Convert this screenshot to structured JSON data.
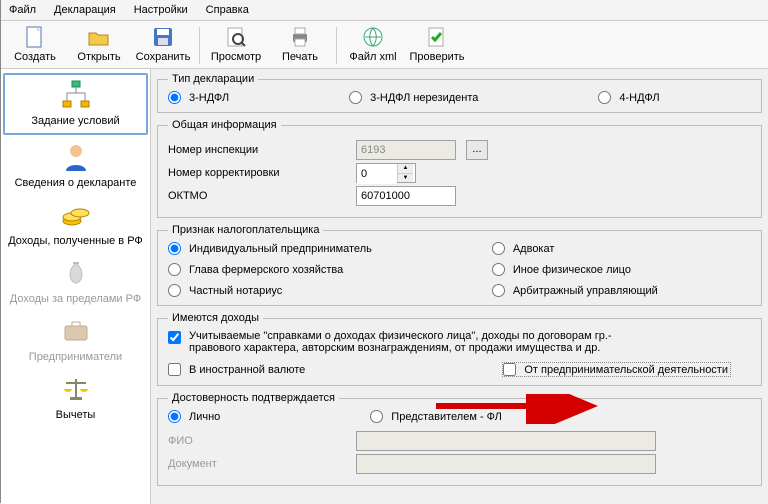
{
  "menu": {
    "items": [
      "Файл",
      "Декларация",
      "Настройки",
      "Справка"
    ]
  },
  "toolbar": {
    "items": [
      {
        "label": "Создать",
        "icon": "new"
      },
      {
        "label": "Открыть",
        "icon": "open"
      },
      {
        "label": "Сохранить",
        "icon": "save"
      }
    ],
    "group2": [
      {
        "label": "Просмотр",
        "icon": "preview"
      },
      {
        "label": "Печать",
        "icon": "print"
      }
    ],
    "group3": [
      {
        "label": "Файл xml",
        "icon": "xml"
      },
      {
        "label": "Проверить",
        "icon": "check"
      }
    ]
  },
  "sidebar": {
    "items": [
      {
        "label": "Задание условий",
        "icon": "tree",
        "active": true
      },
      {
        "label": "Сведения о декларанте",
        "icon": "person"
      },
      {
        "label": "Доходы, полученные в РФ",
        "icon": "coins"
      },
      {
        "label": "Доходы за пределами РФ",
        "icon": "bag",
        "disabled": true
      },
      {
        "label": "Предприниматели",
        "icon": "briefcase",
        "disabled": true
      },
      {
        "label": "Вычеты",
        "icon": "scales"
      }
    ]
  },
  "form": {
    "decl_type": {
      "legend": "Тип декларации",
      "opt1": "3-НДФЛ",
      "opt2": "3-НДФЛ нерезидента",
      "opt3": "4-НДФЛ",
      "selected": 0
    },
    "general": {
      "legend": "Общая информация",
      "inspection_label": "Номер инспекции",
      "inspection_value": "6193",
      "correction_label": "Номер корректировки",
      "correction_value": "0",
      "oktmo_label": "ОКТМО",
      "oktmo_value": "60701000"
    },
    "taxpayer": {
      "legend": "Признак налогоплательщика",
      "col1": [
        "Индивидуальный предприниматель",
        "Глава фермерского хозяйства",
        "Частный нотариус"
      ],
      "col2": [
        "Адвокат",
        "Иное физическое лицо",
        "Арбитражный управляющий"
      ],
      "selected": 0
    },
    "income": {
      "legend": "Имеются доходы",
      "chk1": "Учитываемые \"справками о доходах физического лица\", доходы по договорам гр.-правового характера, авторским вознаграждениям, от продажи имущества и др.",
      "chk2": "В иностранной валюте",
      "chk3": "От предпринимательской деятельности"
    },
    "confirm": {
      "legend": "Достоверность подтверждается",
      "opt1": "Лично",
      "opt2": "Представителем - ФЛ",
      "fio_label": "ФИО",
      "doc_label": "Документ"
    }
  }
}
